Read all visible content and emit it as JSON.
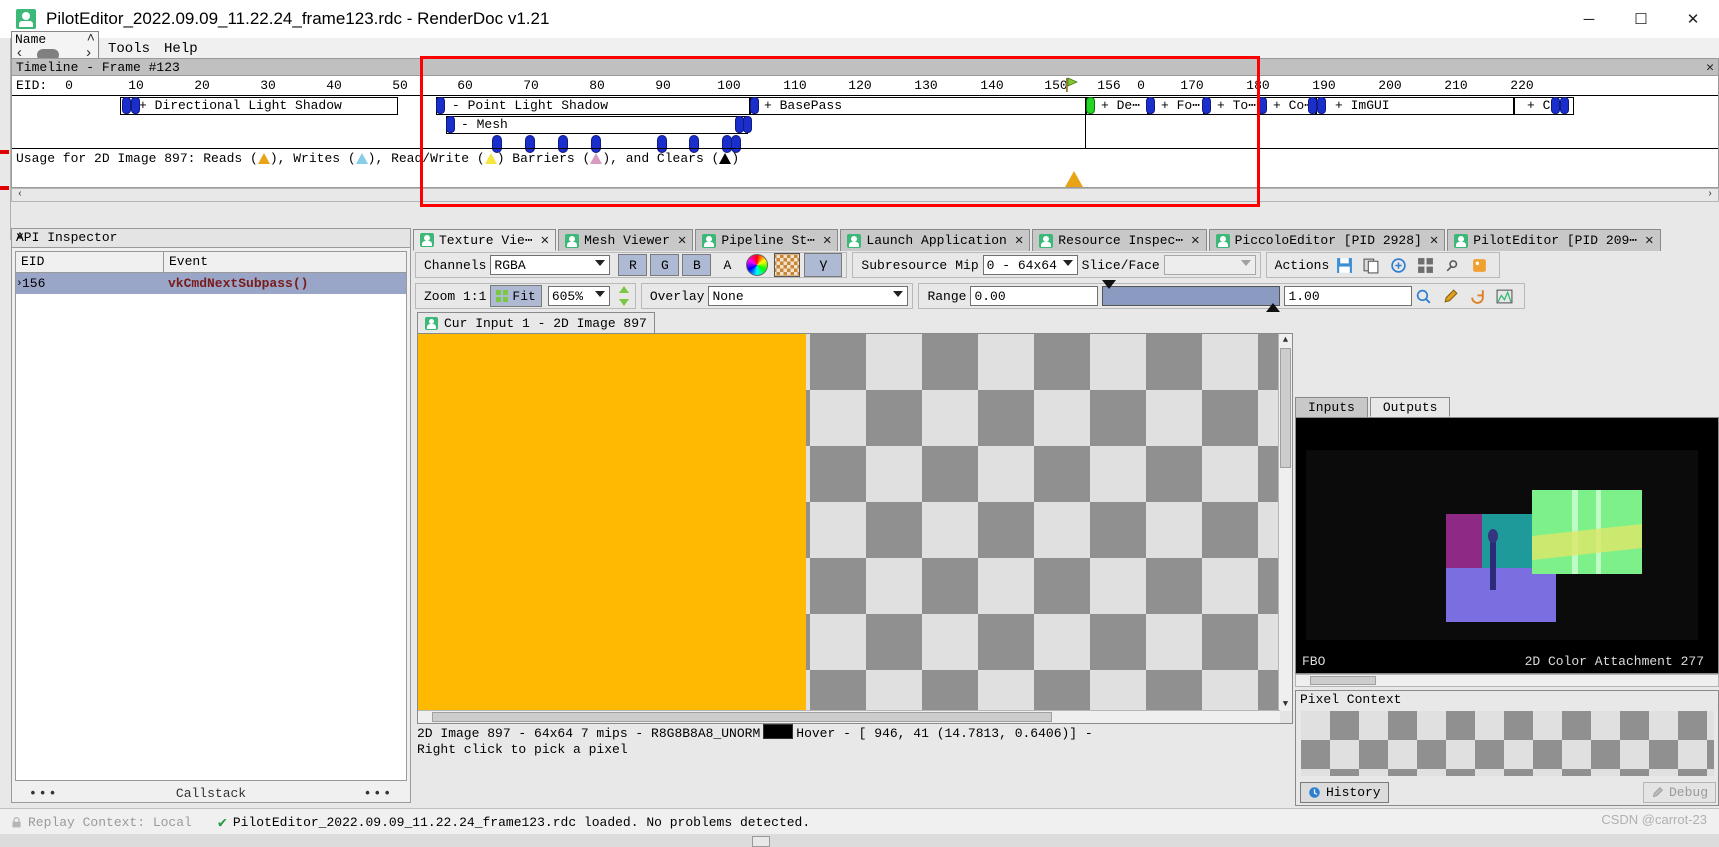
{
  "window": {
    "title": "PilotEditor_2022.09.09_11.22.24_frame123.rdc - RenderDoc v1.21",
    "minimize": "─",
    "maximize": "☐",
    "close": "✕"
  },
  "name_popup": {
    "label": "Name",
    "caret": "˄",
    "left": "‹",
    "right": "›"
  },
  "menu": {
    "items": [
      "Tools",
      "Help"
    ]
  },
  "timeline": {
    "title": "Timeline - Frame #123",
    "close": "✕",
    "eid_label": "EID:",
    "ticks": [
      "0",
      "10",
      "20",
      "30",
      "40",
      "50",
      "60",
      "70",
      "80",
      "90",
      "100",
      "110",
      "120",
      "130",
      "140",
      "150",
      "156",
      "0",
      "170",
      "180",
      "190",
      "200",
      "210",
      "220"
    ],
    "segments_row1": [
      {
        "label": "+ Directional Light Shadow"
      },
      {
        "label": "- Point Light Shadow"
      },
      {
        "label": "+ BasePass"
      },
      {
        "label": "+ De⋯"
      },
      {
        "label": "+ Fo⋯"
      },
      {
        "label": "+ To⋯"
      },
      {
        "label": "+ Co⋯"
      },
      {
        "label": "+ ImGUI"
      },
      {
        "label": "+ Co⋯"
      }
    ],
    "segments_row2": [
      {
        "label": "- Mesh"
      }
    ],
    "usage_text_1": "Usage for 2D Image 897: Reads (",
    "usage_text_2": "), Writes (",
    "usage_text_3": "), Read/Write (",
    "usage_text_4": ") Barriers (",
    "usage_text_5": "), and Clears (",
    "usage_text_6": ")",
    "scroll_left": "‹",
    "scroll_right": "›",
    "current_eid": "156"
  },
  "api_inspector": {
    "title": "API Inspector",
    "close": "✕",
    "columns": [
      "EID",
      "Event"
    ],
    "rows": [
      {
        "eid": "156",
        "event": "vkCmdNextSubpass()",
        "caret": "›"
      }
    ],
    "callstack_label": "Callstack",
    "dots_left": "•••",
    "dots_right": "•••"
  },
  "dock_tabs": [
    {
      "label": "Texture Vie⋯",
      "close": "✕",
      "active": true
    },
    {
      "label": "Mesh Viewer",
      "close": "✕",
      "active": false
    },
    {
      "label": "Pipeline St⋯",
      "close": "✕",
      "active": false
    },
    {
      "label": "Launch Application",
      "close": "✕",
      "active": false
    },
    {
      "label": "Resource Inspec⋯",
      "close": "✕",
      "active": false
    },
    {
      "label": "PiccoloEditor [PID 2928]",
      "close": "✕",
      "active": false
    },
    {
      "label": "PilotEditor [PID 209⋯",
      "close": "✕",
      "active": false
    }
  ],
  "toolbar": {
    "channels_label": "Channels",
    "channels_value": "RGBA",
    "btn_r": "R",
    "btn_g": "G",
    "btn_b": "B",
    "btn_a": "A",
    "gamma": "γ",
    "subresource_label": "Subresource",
    "mip_label": "Mip",
    "mip_value": "0 - 64x64",
    "slice_label": "Slice/Face",
    "slice_value": "",
    "actions_label": "Actions",
    "zoom_label": "Zoom  1:1",
    "fit_label": "Fit",
    "zoom_value": "605%",
    "overlay_label": "Overlay",
    "overlay_value": "None",
    "range_label": "Range",
    "range_min": "0.00",
    "range_max": "1.00"
  },
  "texture": {
    "subtab_label": "Cur Input 1 - 2D Image 897"
  },
  "io": {
    "tabs": [
      "Inputs",
      "Outputs"
    ],
    "active": "Outputs",
    "preview_label_left": "FBO",
    "preview_label_right": "2D Color Attachment 277"
  },
  "pixel_context": {
    "title": "Pixel Context",
    "history_label": "History",
    "debug_label": "Debug"
  },
  "status_info": {
    "line1_a": "2D Image 897 - 64x64 7 mips - R8G8B8A8_UNORM",
    "line1_b": "Hover - [  946,    41 (14.7813, 0.6406)] -",
    "line2": "Right click to pick a pixel"
  },
  "statusbar": {
    "replay_context": "Replay Context: Local",
    "loaded_text": "PilotEditor_2022.09.09_11.22.24_frame123.rdc loaded. No problems detected.",
    "check": "✔",
    "watermark": "CSDN @carrot-23"
  }
}
